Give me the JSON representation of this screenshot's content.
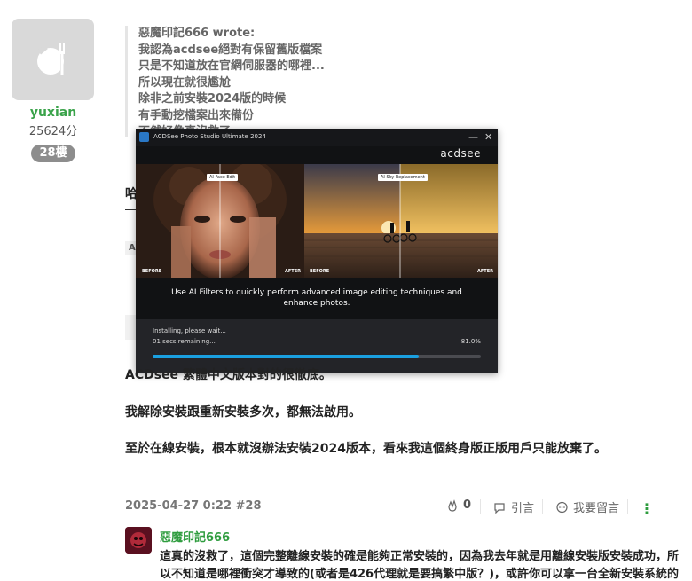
{
  "left_user": {
    "name": "yuxian",
    "points": "25624分",
    "floor": "28樓"
  },
  "quote": {
    "lines": [
      "惡魔印記666 wrote:",
      "我認為acdsee絕對有保留舊版檔案",
      "只是不知道放在官網伺服器的哪裡...",
      "所以現在就很尷尬",
      "除非之前安裝2024版的時候",
      "有手動挖檔案出來備份",
      "不然好像真沒救了"
    ]
  },
  "hidden_fragments": {
    "line_a": "哈",
    "line_b": "Ac"
  },
  "installer": {
    "title": "ACDSee Photo Studio Ultimate 2024",
    "brand": "acdsee",
    "tag_left": "AI Face Edit",
    "tag_right": "AI Sky Replacement",
    "before_label": "BEFORE",
    "after_label": "AFTER",
    "caption": "Use AI Filters to quickly perform advanced image editing techniques and enhance photos.",
    "status_line1": "Installing, please wait...",
    "status_line2": "01 secs remaining...",
    "percent_text": "81.0%",
    "progress": 0.81,
    "minimize": "—",
    "close": "✕"
  },
  "post": {
    "line1": "ACDsee 繁體中文版本對的很徹底。",
    "line2": "我解除安裝跟重新安裝多次，都無法啟用。",
    "line3": "至於在線安裝，根本就沒辦法安裝2024版本，看來我這個終身版正版用戶只能放棄了。"
  },
  "meta": {
    "date": "2025-04-27 0:22 #28",
    "likes": "0",
    "quote_label": "引言",
    "reply_label": "我要留言",
    "menu": "⋮"
  },
  "reply": {
    "user": "惡魔印記666",
    "line1": "這真的沒救了，這個完整離線安裝的確是能夠正常安裝的，因為我去年就是用離線安裝版安裝成功，所",
    "line2": "以不知道是哪裡衝突才導致的(或者是426代理就是要搞繁中版？)，或許你可以拿一台全新安裝系統的"
  },
  "colors": {
    "accent_green": "#2e9c3e",
    "progress_blue": "#1aa0e0"
  }
}
